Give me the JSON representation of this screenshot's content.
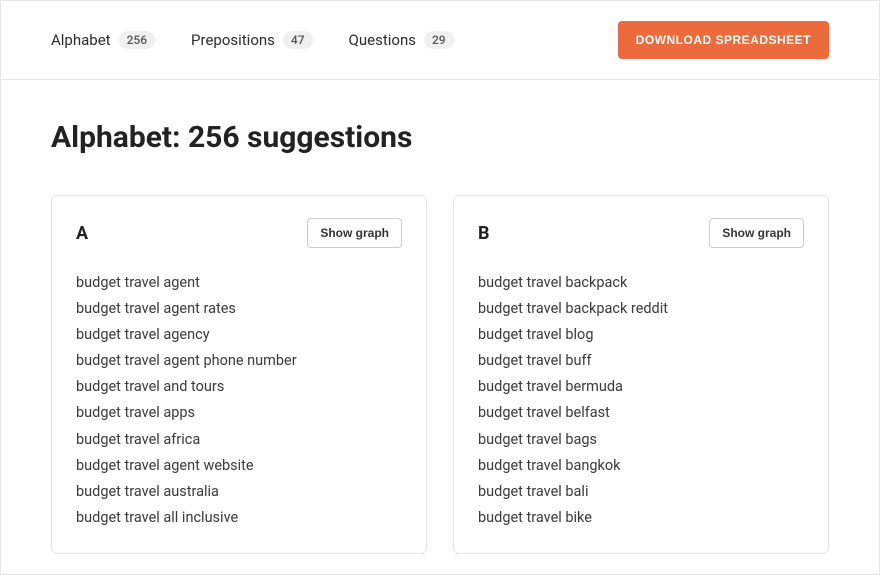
{
  "tabs": [
    {
      "label": "Alphabet",
      "count": "256"
    },
    {
      "label": "Prepositions",
      "count": "47"
    },
    {
      "label": "Questions",
      "count": "29"
    }
  ],
  "download_label": "DOWNLOAD SPREADSHEET",
  "heading": "Alphabet: 256 suggestions",
  "show_graph_label": "Show graph",
  "cards": [
    {
      "letter": "A",
      "items": [
        "budget travel agent",
        "budget travel agent rates",
        "budget travel agency",
        "budget travel agent phone number",
        "budget travel and tours",
        "budget travel apps",
        "budget travel africa",
        "budget travel agent website",
        "budget travel australia",
        "budget travel all inclusive"
      ]
    },
    {
      "letter": "B",
      "items": [
        "budget travel backpack",
        "budget travel backpack reddit",
        "budget travel blog",
        "budget travel buff",
        "budget travel bermuda",
        "budget travel belfast",
        "budget travel bags",
        "budget travel bangkok",
        "budget travel bali",
        "budget travel bike"
      ]
    }
  ]
}
